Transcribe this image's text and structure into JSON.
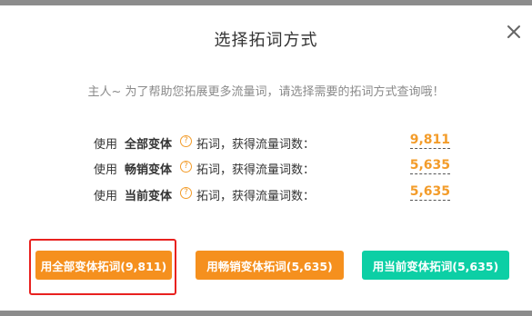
{
  "dialog": {
    "title": "选择拓词方式",
    "subtitle": "主人~ 为了帮助您拓展更多流量词，请选择需要的拓词方式查询哦！"
  },
  "rows": [
    {
      "prefix": "使用",
      "variant": "全部变体",
      "help_glyph": "?",
      "suffix": "拓词，获得流量词数：",
      "count": "9,811"
    },
    {
      "prefix": "使用",
      "variant": "畅销变体",
      "help_glyph": "?",
      "suffix": "拓词，获得流量词数：",
      "count": "5,635"
    },
    {
      "prefix": "使用",
      "variant": "当前变体",
      "help_glyph": "?",
      "suffix": "拓词，获得流量词数：",
      "count": "5,635"
    }
  ],
  "buttons": {
    "all": "用全部变体拓词(9,811)",
    "bestseller": "用畅销变体拓词(5,635)",
    "current": "用当前变体拓词(5,635)"
  },
  "colors": {
    "accent_orange": "#f5901e",
    "accent_teal": "#0ccfa5",
    "highlight_red": "#e8211f",
    "count_orange": "#f39c2a"
  },
  "icons": {
    "close": "close-icon",
    "help": "help-circle-icon"
  }
}
